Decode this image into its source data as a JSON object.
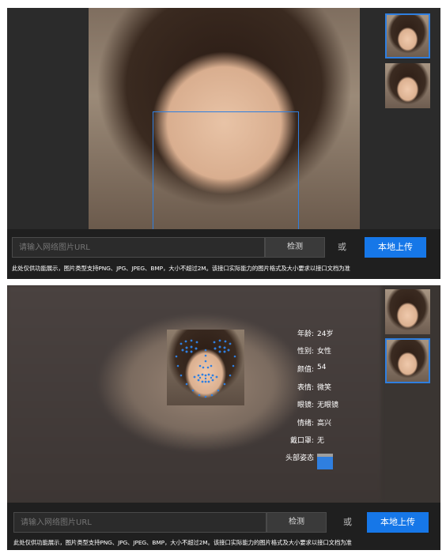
{
  "panel_top": {
    "input_placeholder": "请输入网络图片URL",
    "detect_label": "检测",
    "or_label": "或",
    "upload_label": "本地上传",
    "note": "此处仅供功能展示，图片类型支持PNG、JPG、JPEG、BMP，大小不超过2M。该接口实际能力的图片格式及大小要求以接口文档为准",
    "selected_thumbnail": 1
  },
  "panel_bottom": {
    "input_placeholder": "请输入网络图片URL",
    "detect_label": "检测",
    "or_label": "或",
    "upload_label": "本地上传",
    "note": "此处仅供功能展示，图片类型支持PNG、JPG、JPEG、BMP，大小不超过2M。该接口实际能力的图片格式及大小要求以接口文档为准",
    "selected_thumbnail": 2,
    "attributes": [
      {
        "label": "年龄:",
        "value": "24岁"
      },
      {
        "label": "性别:",
        "value": "女性"
      },
      {
        "label": "颜值:",
        "value": "54"
      },
      {
        "label": "表情:",
        "value": "微笑"
      },
      {
        "label": "眼镜:",
        "value": "无眼镜"
      },
      {
        "label": "情绪:",
        "value": "高兴"
      },
      {
        "label": "戴口罩:",
        "value": "无"
      },
      {
        "label": "头部姿态",
        "value": ""
      }
    ]
  },
  "colors": {
    "accent": "#1677e8",
    "box": "#2f7fe0",
    "bar_bg": "#1f1f1f"
  }
}
